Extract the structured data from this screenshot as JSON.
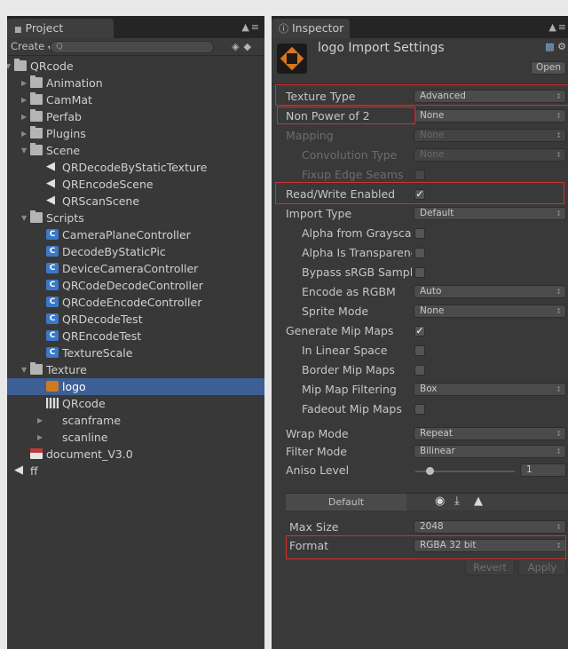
{
  "project": {
    "tab_label": "Project",
    "create_label": "Create",
    "search_placeholder": "Q",
    "tree": [
      {
        "label": "QRcode",
        "kind": "folder",
        "depth": 0,
        "expanded": true
      },
      {
        "label": "Animation",
        "kind": "folder",
        "depth": 1
      },
      {
        "label": "CamMat",
        "kind": "folder",
        "depth": 1
      },
      {
        "label": "Perfab",
        "kind": "folder",
        "depth": 1
      },
      {
        "label": "Plugins",
        "kind": "folder",
        "depth": 1
      },
      {
        "label": "Scene",
        "kind": "folder",
        "depth": 1,
        "expanded": true
      },
      {
        "label": "QRDecodeByStaticTexture",
        "kind": "scene",
        "depth": 2
      },
      {
        "label": "QREncodeScene",
        "kind": "scene",
        "depth": 2
      },
      {
        "label": "QRScanScene",
        "kind": "scene",
        "depth": 2
      },
      {
        "label": "Scripts",
        "kind": "folder",
        "depth": 1,
        "expanded": true
      },
      {
        "label": "CameraPlaneController",
        "kind": "script",
        "depth": 2
      },
      {
        "label": "DecodeByStaticPic",
        "kind": "script",
        "depth": 2
      },
      {
        "label": "DeviceCameraController",
        "kind": "script",
        "depth": 2
      },
      {
        "label": "QRCodeDecodeController",
        "kind": "script",
        "depth": 2
      },
      {
        "label": "QRCodeEncodeController",
        "kind": "script",
        "depth": 2
      },
      {
        "label": "QRDecodeTest",
        "kind": "script",
        "depth": 2
      },
      {
        "label": "QREncodeTest",
        "kind": "script",
        "depth": 2
      },
      {
        "label": "TextureScale",
        "kind": "script",
        "depth": 2
      },
      {
        "label": "Texture",
        "kind": "folder",
        "depth": 1,
        "expanded": true
      },
      {
        "label": "logo",
        "kind": "logo",
        "depth": 2,
        "selected": true
      },
      {
        "label": "QRcode",
        "kind": "qr",
        "depth": 2
      },
      {
        "label": "scanframe",
        "kind": "blank",
        "depth": 2,
        "arrow": true
      },
      {
        "label": "scanline",
        "kind": "blank",
        "depth": 2,
        "arrow": true
      },
      {
        "label": "document_V3.0",
        "kind": "doc",
        "depth": 1
      },
      {
        "label": "ff",
        "kind": "scene",
        "depth": 0
      }
    ]
  },
  "inspector": {
    "tab_label": "Inspector",
    "title": "logo Import Settings",
    "open_label": "Open",
    "texture_type": {
      "label": "Texture Type",
      "value": "Advanced"
    },
    "non_power_of_2": {
      "label": "Non Power of 2",
      "value": "None"
    },
    "mapping": {
      "label": "Mapping",
      "value": "None"
    },
    "convolution_type": {
      "label": "Convolution Type",
      "value": "None"
    },
    "fixup_edge_seams": {
      "label": "Fixup Edge Seams"
    },
    "read_write_enabled": {
      "label": "Read/Write Enabled",
      "checked": true
    },
    "import_type": {
      "label": "Import Type",
      "value": "Default"
    },
    "alpha_from_grayscale": {
      "label": "Alpha from Grayscale",
      "checked": false
    },
    "alpha_is_transparency": {
      "label": "Alpha Is Transparency",
      "checked": false
    },
    "bypass_srgb": {
      "label": "Bypass sRGB Sampling",
      "checked": false
    },
    "encode_as_rgbm": {
      "label": "Encode as RGBM",
      "value": "Auto"
    },
    "sprite_mode": {
      "label": "Sprite Mode",
      "value": "None"
    },
    "generate_mip_maps": {
      "label": "Generate Mip Maps",
      "checked": true
    },
    "in_linear_space": {
      "label": "In Linear Space",
      "checked": false
    },
    "border_mip_maps": {
      "label": "Border Mip Maps",
      "checked": false
    },
    "mip_map_filtering": {
      "label": "Mip Map Filtering",
      "value": "Box"
    },
    "fadeout_mip_maps": {
      "label": "Fadeout Mip Maps",
      "checked": false
    },
    "wrap_mode": {
      "label": "Wrap Mode",
      "value": "Repeat"
    },
    "filter_mode": {
      "label": "Filter Mode",
      "value": "Bilinear"
    },
    "aniso_level": {
      "label": "Aniso Level",
      "value": "1"
    },
    "platform_tab": "Default",
    "max_size": {
      "label": "Max Size",
      "value": "2048"
    },
    "format": {
      "label": "Format",
      "value": "RGBA 32 bit"
    },
    "revert_label": "Revert",
    "apply_label": "Apply"
  },
  "colors": {
    "selection": "#3e5f96",
    "highlight_box": "#d03030",
    "panel": "#383838"
  }
}
